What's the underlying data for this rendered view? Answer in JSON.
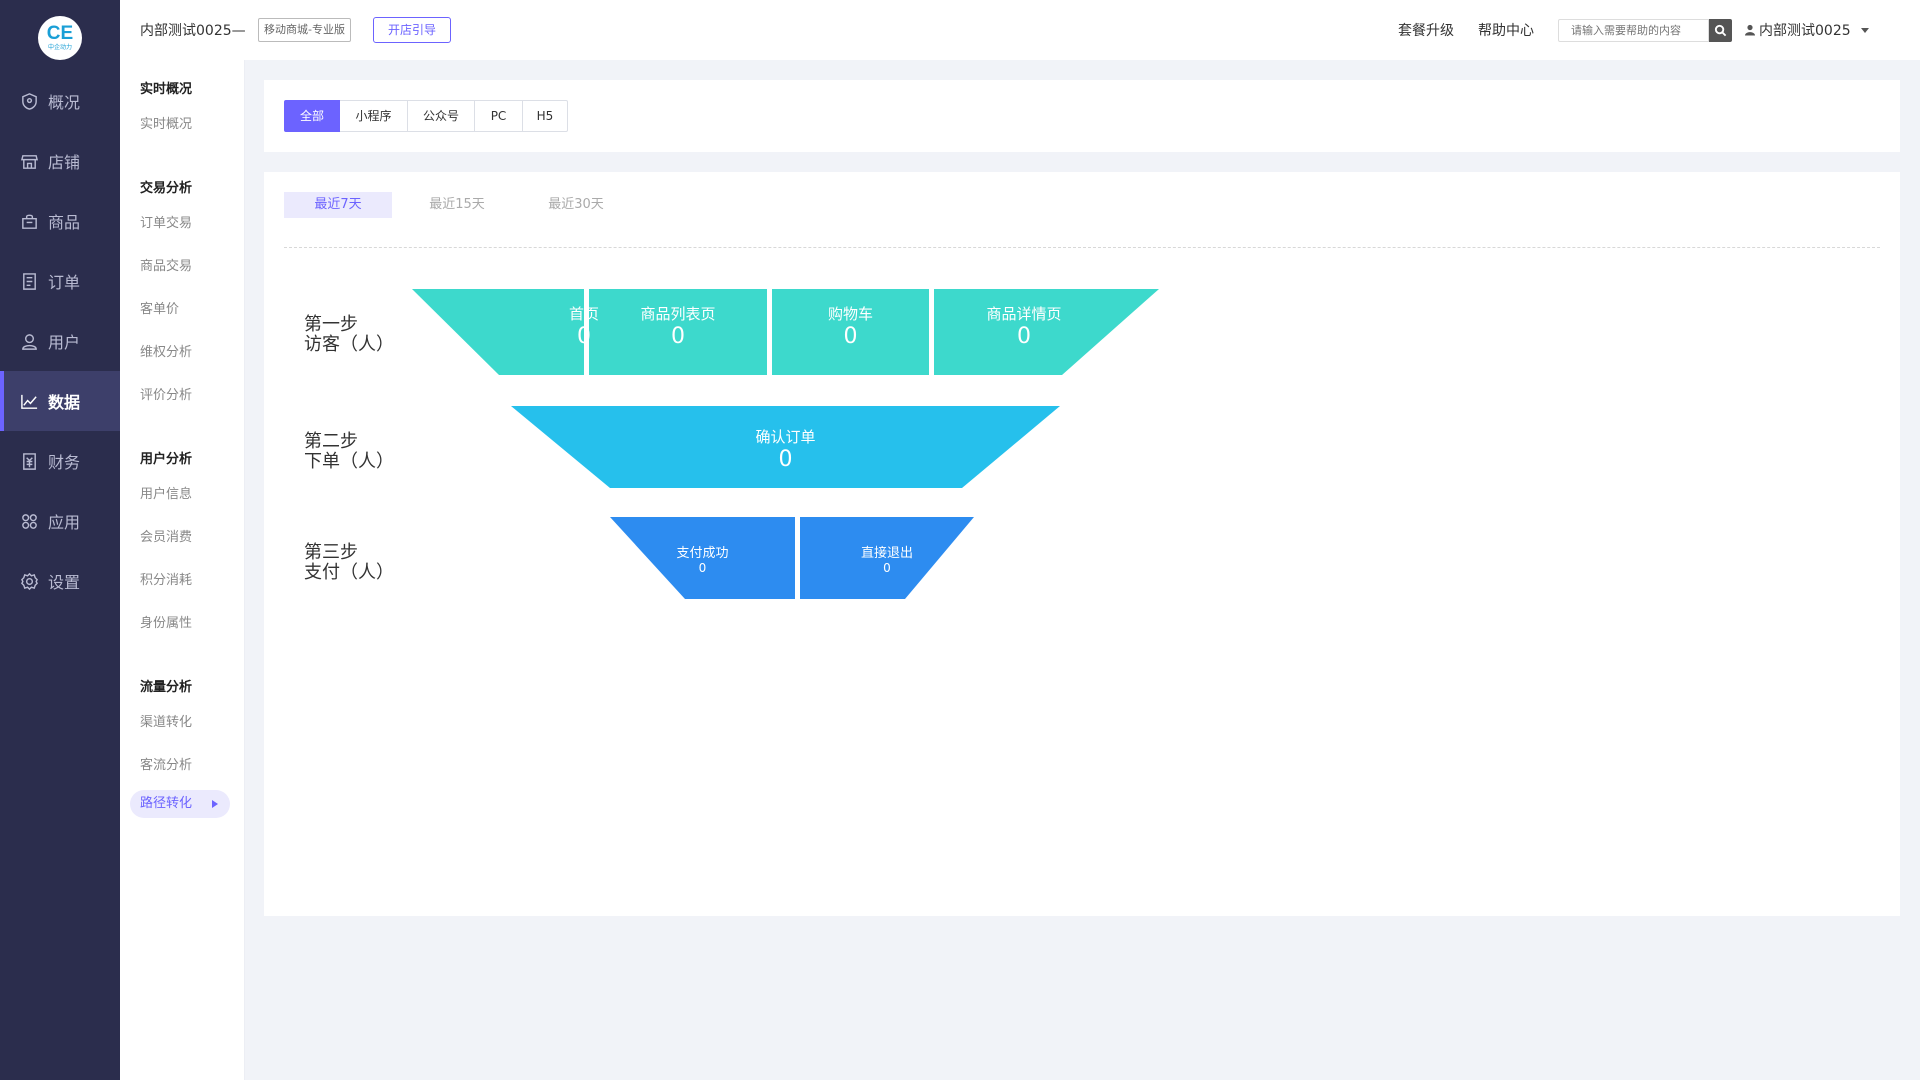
{
  "sidebar": {
    "logo": {
      "mark": "CE",
      "text": "中企动力"
    },
    "items": [
      {
        "label": "概况",
        "icon": "shield-icon"
      },
      {
        "label": "店铺",
        "icon": "store-icon"
      },
      {
        "label": "商品",
        "icon": "bag-icon"
      },
      {
        "label": "订单",
        "icon": "document-icon"
      },
      {
        "label": "用户",
        "icon": "user-icon"
      },
      {
        "label": "数据",
        "icon": "chart-icon",
        "active": true
      },
      {
        "label": "财务",
        "icon": "finance-icon"
      },
      {
        "label": "应用",
        "icon": "apps-icon"
      },
      {
        "label": "设置",
        "icon": "gear-icon"
      }
    ]
  },
  "submenu": {
    "groups": [
      {
        "title": "实时概况",
        "items": [
          "实时概况"
        ]
      },
      {
        "title": "交易分析",
        "items": [
          "订单交易",
          "商品交易",
          "客单价",
          "维权分析",
          "评价分析"
        ]
      },
      {
        "title": "用户分析",
        "items": [
          "用户信息",
          "会员消费",
          "积分消耗",
          "身份属性"
        ]
      },
      {
        "title": "流量分析",
        "items": [
          "渠道转化",
          "客流分析",
          "路径转化"
        ]
      }
    ],
    "active": "路径转化"
  },
  "header": {
    "shop_name": "内部测试0025—",
    "edition": "移动商城-专业版",
    "guide_button": "开店引导",
    "upgrade": "套餐升级",
    "help": "帮助中心",
    "search_placeholder": "请输入需要帮助的内容",
    "username": "内部测试0025"
  },
  "channel_tabs": {
    "items": [
      "全部",
      "小程序",
      "公众号",
      "PC",
      "H5"
    ],
    "active": "全部"
  },
  "time_tabs": {
    "items": [
      "最近7天",
      "最近15天",
      "最近30天"
    ],
    "active": "最近7天"
  },
  "funnel": {
    "steps": [
      {
        "step": "第一步",
        "name": "访客（人）",
        "color": "#3dd9cc",
        "segments": [
          {
            "label": "首页",
            "value": "0"
          },
          {
            "label": "商品列表页",
            "value": "0"
          },
          {
            "label": "购物车",
            "value": "0"
          },
          {
            "label": "商品详情页",
            "value": "0"
          }
        ]
      },
      {
        "step": "第二步",
        "name": "下单（人）",
        "color": "#26c0ec",
        "segments": [
          {
            "label": "确认订单",
            "value": "0"
          }
        ]
      },
      {
        "step": "第三步",
        "name": "支付（人）",
        "color": "#2d8cf0",
        "segments": [
          {
            "label": "支付成功",
            "value": "0"
          },
          {
            "label": "直接退出",
            "value": "0"
          }
        ]
      }
    ]
  }
}
